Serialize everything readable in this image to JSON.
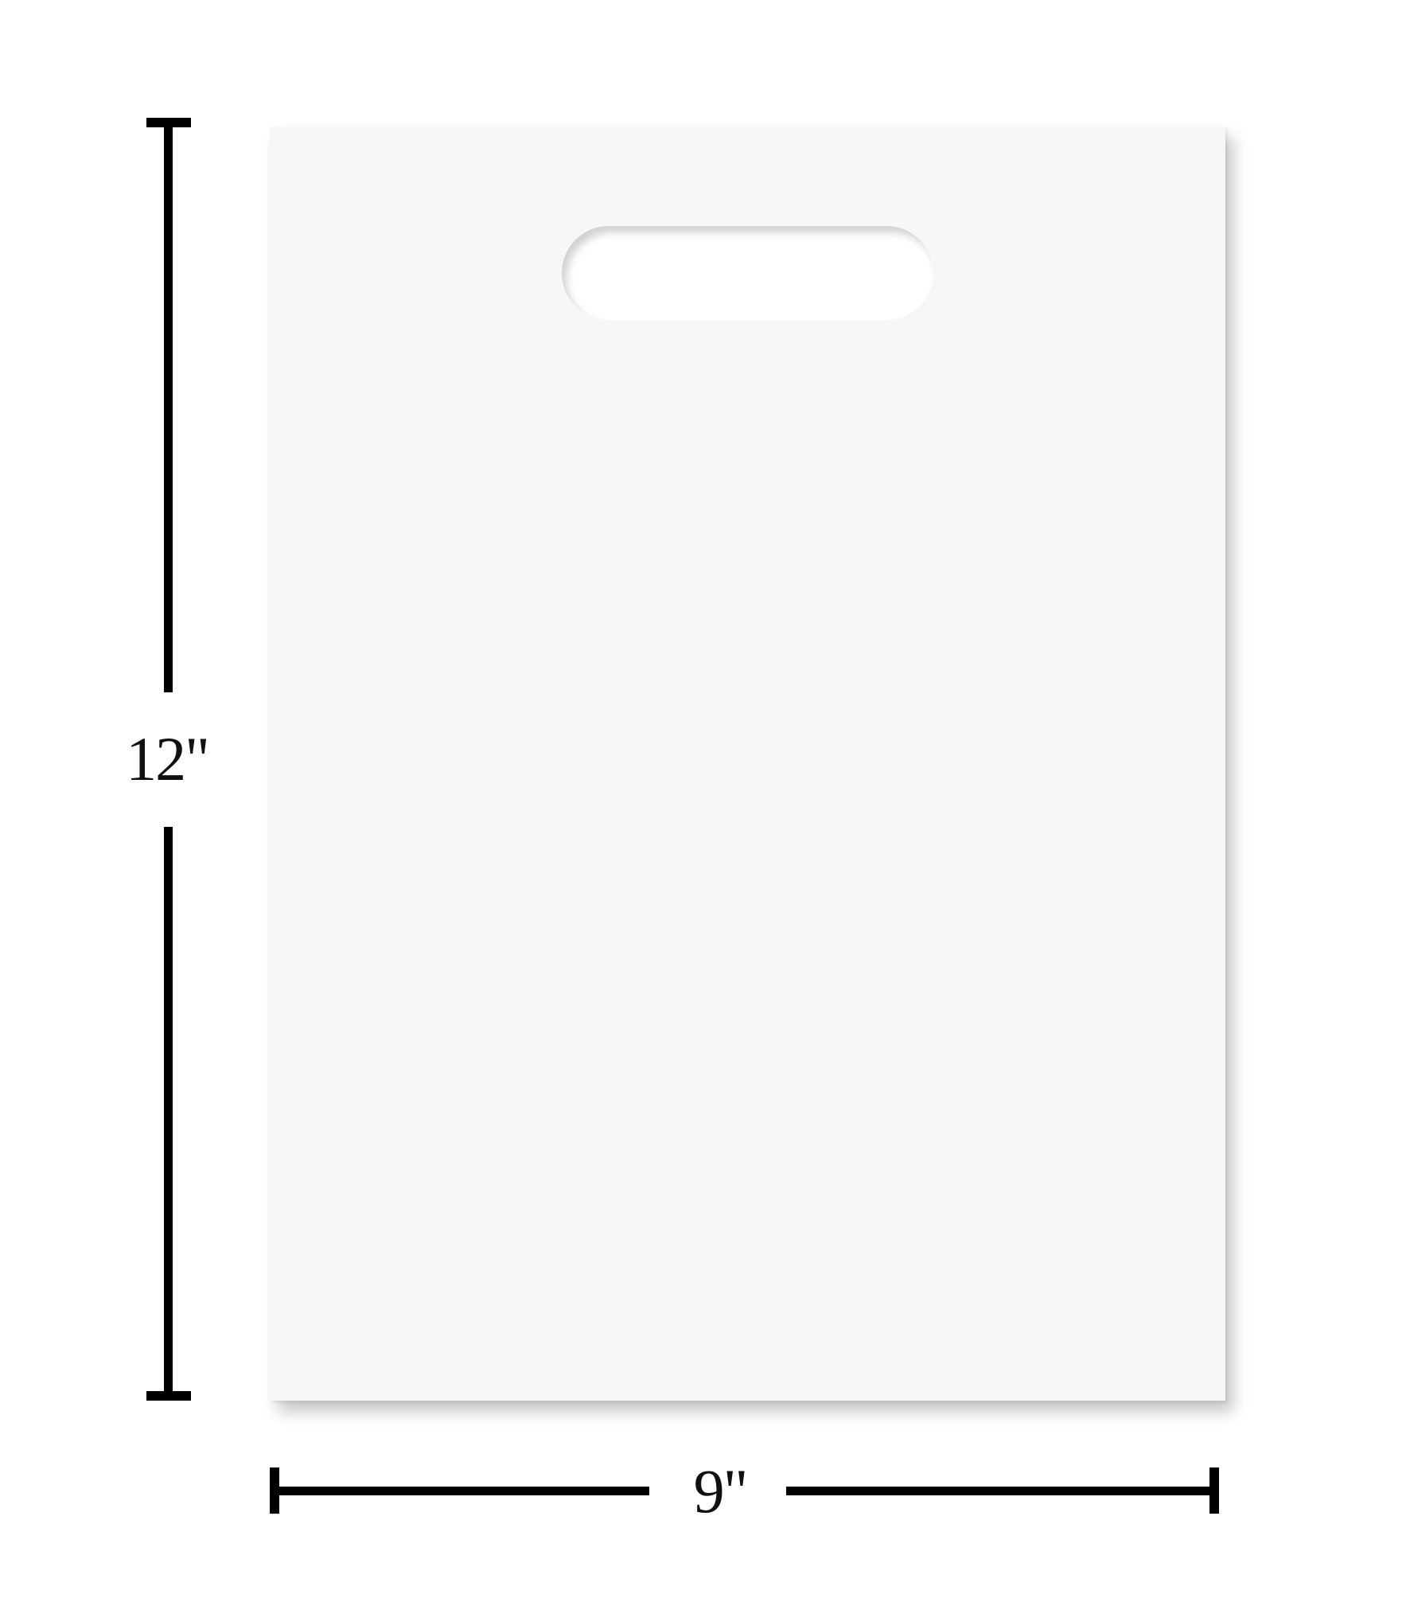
{
  "dimensions": {
    "height_label": "12\"",
    "width_label": "9\""
  },
  "colors": {
    "bag_fill": "#f7f7f7",
    "dimension_lines": "#000000",
    "background": "#ffffff"
  }
}
